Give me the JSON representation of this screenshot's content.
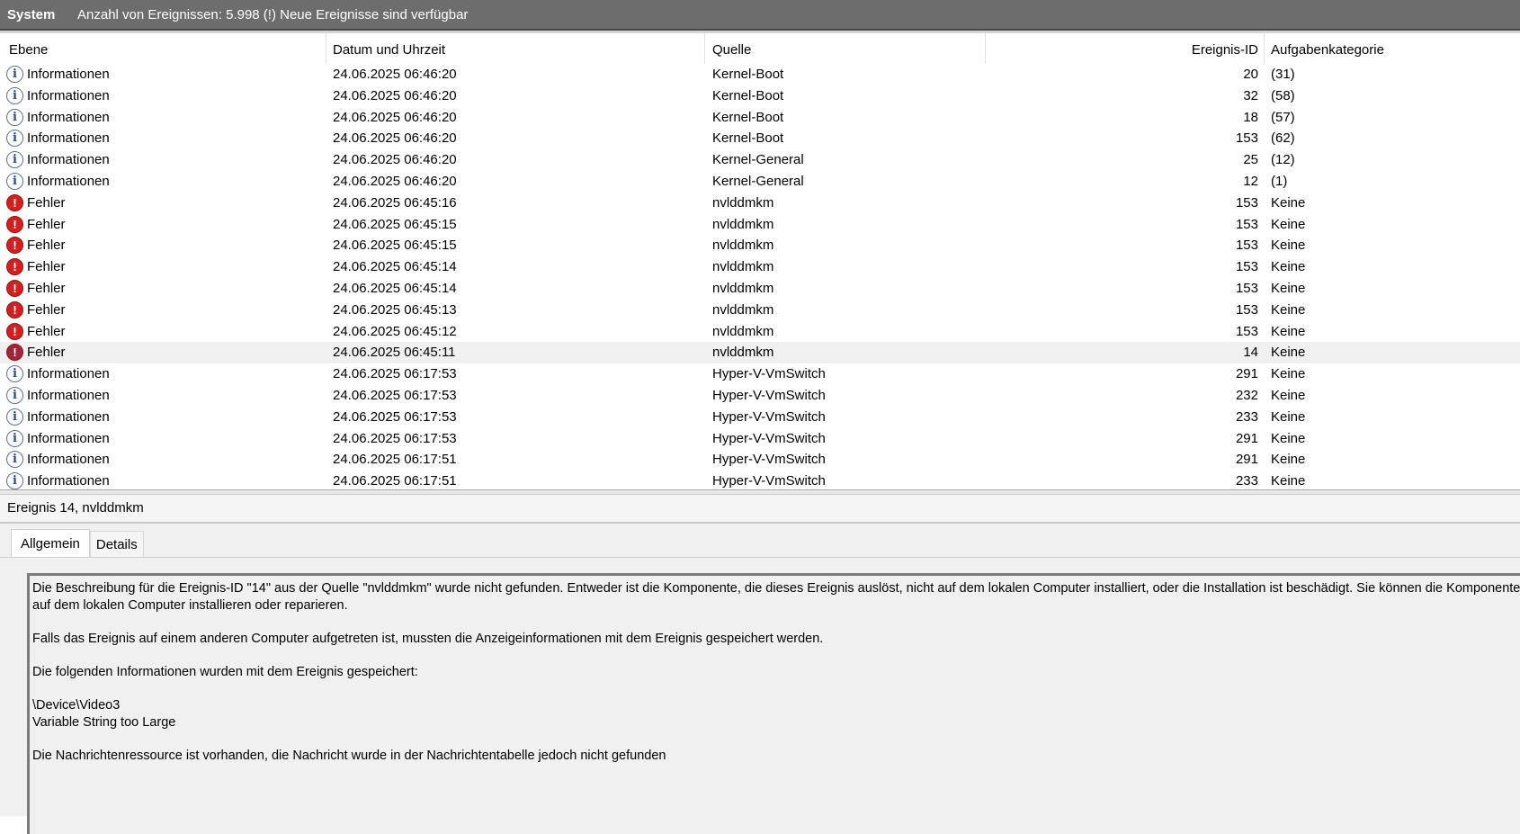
{
  "header": {
    "title": "System",
    "info": "Anzahl von Ereignissen: 5.998 (!) Neue Ereignisse sind verfügbar"
  },
  "columns": {
    "level": "Ebene",
    "date": "Datum und Uhrzeit",
    "source": "Quelle",
    "id": "Ereignis-ID",
    "category": "Aufgabenkategorie"
  },
  "rows": [
    {
      "type": "info",
      "level": "Informationen",
      "date": "24.06.2025 06:46:20",
      "source": "Kernel-Boot",
      "id": "20",
      "category": "(31)"
    },
    {
      "type": "info",
      "level": "Informationen",
      "date": "24.06.2025 06:46:20",
      "source": "Kernel-Boot",
      "id": "32",
      "category": "(58)"
    },
    {
      "type": "info",
      "level": "Informationen",
      "date": "24.06.2025 06:46:20",
      "source": "Kernel-Boot",
      "id": "18",
      "category": "(57)"
    },
    {
      "type": "info",
      "level": "Informationen",
      "date": "24.06.2025 06:46:20",
      "source": "Kernel-Boot",
      "id": "153",
      "category": "(62)"
    },
    {
      "type": "info",
      "level": "Informationen",
      "date": "24.06.2025 06:46:20",
      "source": "Kernel-General",
      "id": "25",
      "category": "(12)"
    },
    {
      "type": "info",
      "level": "Informationen",
      "date": "24.06.2025 06:46:20",
      "source": "Kernel-General",
      "id": "12",
      "category": "(1)"
    },
    {
      "type": "error",
      "level": "Fehler",
      "date": "24.06.2025 06:45:16",
      "source": "nvlddmkm",
      "id": "153",
      "category": "Keine"
    },
    {
      "type": "error",
      "level": "Fehler",
      "date": "24.06.2025 06:45:15",
      "source": "nvlddmkm",
      "id": "153",
      "category": "Keine"
    },
    {
      "type": "error",
      "level": "Fehler",
      "date": "24.06.2025 06:45:15",
      "source": "nvlddmkm",
      "id": "153",
      "category": "Keine"
    },
    {
      "type": "error",
      "level": "Fehler",
      "date": "24.06.2025 06:45:14",
      "source": "nvlddmkm",
      "id": "153",
      "category": "Keine"
    },
    {
      "type": "error",
      "level": "Fehler",
      "date": "24.06.2025 06:45:14",
      "source": "nvlddmkm",
      "id": "153",
      "category": "Keine"
    },
    {
      "type": "error",
      "level": "Fehler",
      "date": "24.06.2025 06:45:13",
      "source": "nvlddmkm",
      "id": "153",
      "category": "Keine"
    },
    {
      "type": "error",
      "level": "Fehler",
      "date": "24.06.2025 06:45:12",
      "source": "nvlddmkm",
      "id": "153",
      "category": "Keine"
    },
    {
      "type": "error",
      "level": "Fehler",
      "date": "24.06.2025 06:45:11",
      "source": "nvlddmkm",
      "id": "14",
      "category": "Keine",
      "selected": true
    },
    {
      "type": "info",
      "level": "Informationen",
      "date": "24.06.2025 06:17:53",
      "source": "Hyper-V-VmSwitch",
      "id": "291",
      "category": "Keine"
    },
    {
      "type": "info",
      "level": "Informationen",
      "date": "24.06.2025 06:17:53",
      "source": "Hyper-V-VmSwitch",
      "id": "232",
      "category": "Keine"
    },
    {
      "type": "info",
      "level": "Informationen",
      "date": "24.06.2025 06:17:53",
      "source": "Hyper-V-VmSwitch",
      "id": "233",
      "category": "Keine"
    },
    {
      "type": "info",
      "level": "Informationen",
      "date": "24.06.2025 06:17:53",
      "source": "Hyper-V-VmSwitch",
      "id": "291",
      "category": "Keine"
    },
    {
      "type": "info",
      "level": "Informationen",
      "date": "24.06.2025 06:17:51",
      "source": "Hyper-V-VmSwitch",
      "id": "291",
      "category": "Keine"
    },
    {
      "type": "info",
      "level": "Informationen",
      "date": "24.06.2025 06:17:51",
      "source": "Hyper-V-VmSwitch",
      "id": "233",
      "category": "Keine"
    }
  ],
  "icons": {
    "info_glyph": "i",
    "error_glyph": "!",
    "info_name": "information-icon",
    "error_name": "error-icon"
  },
  "detail": {
    "title": "Ereignis 14, nvlddmkm",
    "tabs": [
      "Allgemein",
      "Details"
    ],
    "description": {
      "p1": "Die Beschreibung für die Ereignis-ID \"14\" aus der Quelle \"nvlddmkm\" wurde nicht gefunden. Entweder ist die Komponente, die dieses Ereignis auslöst, nicht auf dem lokalen Computer installiert, oder die Installation ist beschädigt. Sie können die Komponente auf dem lokalen Computer installieren oder reparieren.",
      "p2": "Falls das Ereignis auf einem anderen Computer aufgetreten ist, mussten die Anzeigeinformationen mit dem Ereignis gespeichert werden.",
      "p3": "Die folgenden Informationen wurden mit dem Ereignis gespeichert:",
      "p4a": "\\Device\\Video3",
      "p4b": "Variable String too Large",
      "p5": "Die Nachrichtenressource ist vorhanden, die Nachricht wurde in der Nachrichtentabelle jedoch nicht gefunden"
    }
  }
}
